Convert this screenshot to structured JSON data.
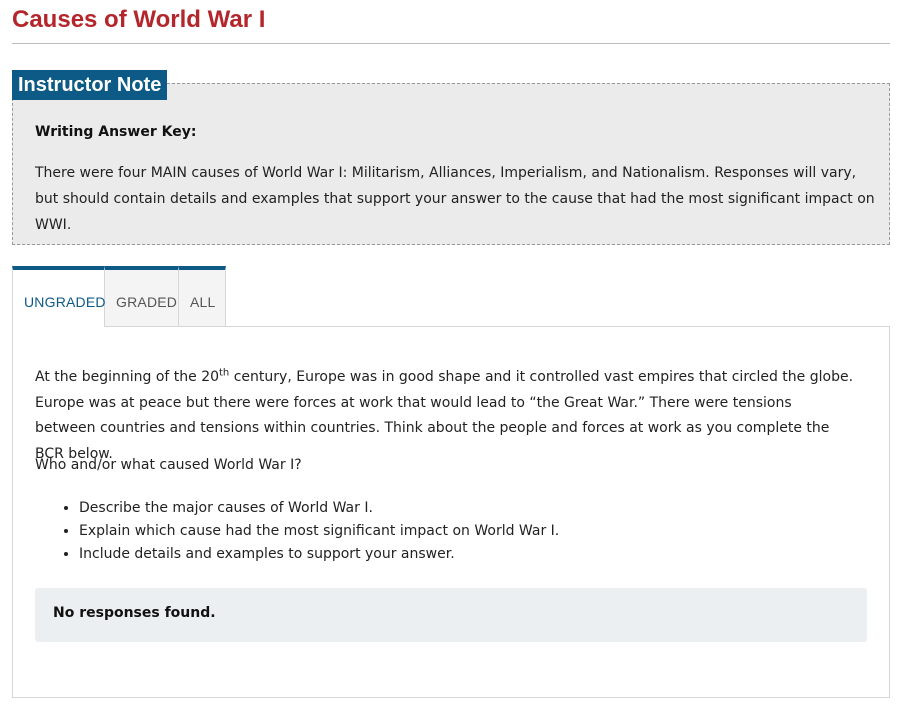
{
  "page": {
    "title": "Causes of World War I"
  },
  "instructor_note": {
    "label": "Instructor Note",
    "heading": "Writing Answer Key:",
    "text": "There were four MAIN causes of World War I: Militarism, Alliances, Imperialism, and Nationalism. Responses will vary, but should contain details and examples that support your answer to the cause that had the most significant impact on WWI."
  },
  "tabs": [
    {
      "label": "UNGRADED",
      "active": true
    },
    {
      "label": "GRADED",
      "active": false
    },
    {
      "label": "ALL",
      "active": false
    }
  ],
  "prompt": {
    "part1": "At the beginning of the 20",
    "sup": "th",
    "part2": " century, Europe was in good shape and it controlled vast empires that circled the globe. Europe was at peace but there were forces at work that would lead to “the Great War.” There were tensions between countries and tensions within countries. Think about the people and forces at work as you complete the BCR below.",
    "question": "Who and/or what caused World War I?",
    "bullets": [
      "Describe the major causes of World War I.",
      "Explain which cause had the most significant impact on World War I.",
      "Include details and examples to support your answer."
    ]
  },
  "responses": {
    "empty_text": "No responses found."
  },
  "colors": {
    "title": "#b3262b",
    "accent": "#0d5a86",
    "note_background": "#ebebeb",
    "empty_background": "#eceff1"
  }
}
